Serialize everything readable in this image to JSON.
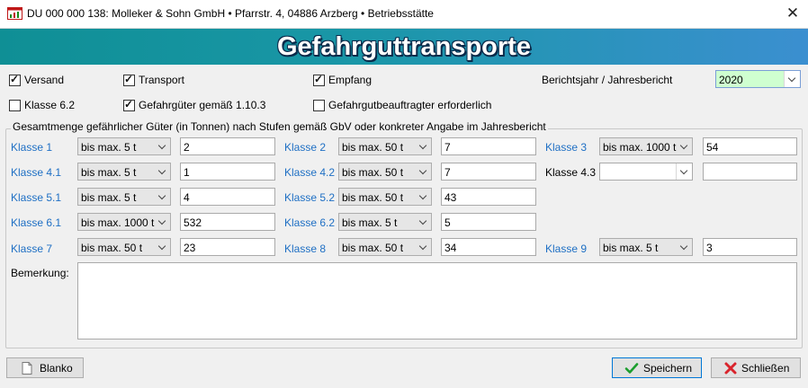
{
  "window": {
    "title": "DU  000 000 138: Molleker & Sohn GmbH • Pfarrstr. 4, 04886 Arzberg • Betriebsstätte",
    "close_symbol": "✕"
  },
  "banner": {
    "title": "Gefahrguttransporte"
  },
  "checkboxes": {
    "versand": {
      "label": "Versand",
      "checked": true
    },
    "transport": {
      "label": "Transport",
      "checked": true
    },
    "empfang": {
      "label": "Empfang",
      "checked": true
    },
    "klasse62": {
      "label": "Klasse 6.2",
      "checked": false
    },
    "gefahrgueter": {
      "label": "Gefahrgüter gemäß 1.10.3",
      "checked": true
    },
    "beauftragter": {
      "label": "Gefahrgutbeauftragter erforderlich",
      "checked": false
    }
  },
  "report_year": {
    "label": "Berichtsjahr / Jahresbericht",
    "value": "2020"
  },
  "group_title": "Gesamtmenge gefährlicher Güter (in Tonnen) nach Stufen gemäß GbV oder konkreter Angabe im Jahresbericht",
  "classes": {
    "k1": {
      "label": "Klasse 1",
      "level": "bis max. 5 t",
      "amount": "2"
    },
    "k2": {
      "label": "Klasse 2",
      "level": "bis max. 50 t",
      "amount": "7"
    },
    "k3": {
      "label": "Klasse 3",
      "level": "bis max. 1000 t",
      "amount": "54"
    },
    "k41": {
      "label": "Klasse 4.1",
      "level": "bis max. 5 t",
      "amount": "1"
    },
    "k42": {
      "label": "Klasse 4.2",
      "level": "bis max. 50 t",
      "amount": "7"
    },
    "k43": {
      "label": "Klasse 4.3",
      "level": "",
      "amount": ""
    },
    "k51": {
      "label": "Klasse 5.1",
      "level": "bis max. 5 t",
      "amount": "4"
    },
    "k52": {
      "label": "Klasse 5.2",
      "level": "bis max. 50 t",
      "amount": "43"
    },
    "k61": {
      "label": "Klasse 6.1",
      "level": "bis max. 1000 t",
      "amount": "532"
    },
    "k62": {
      "label": "Klasse 6.2",
      "level": "bis max. 5 t",
      "amount": "5"
    },
    "k7": {
      "label": "Klasse 7",
      "level": "bis max. 50 t",
      "amount": "23"
    },
    "k8": {
      "label": "Klasse 8",
      "level": "bis max. 50 t",
      "amount": "34"
    },
    "k9": {
      "label": "Klasse 9",
      "level": "bis max. 5 t",
      "amount": "3"
    }
  },
  "remark": {
    "label": "Bemerkung:",
    "value": ""
  },
  "buttons": {
    "blanko": {
      "label": "Blanko",
      "icon": "document-icon"
    },
    "save": {
      "label": "Speichern",
      "icon": "checkmark-icon"
    },
    "close": {
      "label": "Schließen",
      "icon": "red-x-icon"
    }
  },
  "colors": {
    "class_label": "#1e6fc4",
    "banner_start": "#0f8f95",
    "banner_end": "#3b8fd0",
    "year_field": "#cfffd0"
  }
}
